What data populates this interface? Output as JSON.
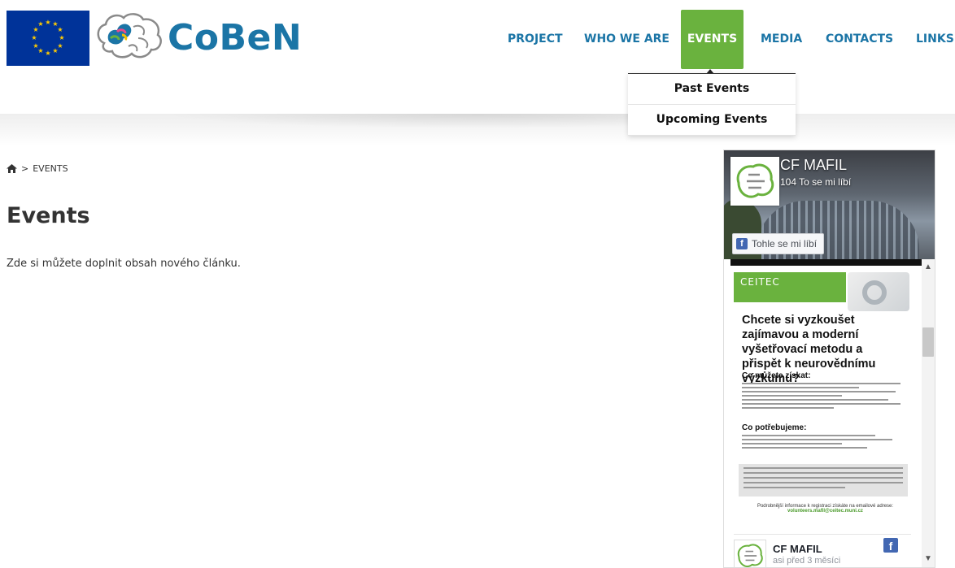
{
  "header": {
    "brand_name": "CoBeN",
    "flag_icon": "eu-flag-icon",
    "logo_icon": "brain-logo-icon"
  },
  "nav": {
    "items": [
      {
        "label": "PROJECT"
      },
      {
        "label": "WHO WE ARE"
      },
      {
        "label": "EVENTS",
        "active": true
      },
      {
        "label": "MEDIA"
      },
      {
        "label": "CONTACTS"
      },
      {
        "label": "LINKS"
      }
    ],
    "dropdown": [
      {
        "label": "Past Events"
      },
      {
        "label": "Upcoming Events"
      }
    ]
  },
  "breadcrumb": {
    "separator": ">",
    "current": "EVENTS"
  },
  "page": {
    "title": "Events",
    "text": "Zde si můžete doplnit obsah nového článku."
  },
  "facebook": {
    "page_name": "CF MAFIL",
    "likes": "104 To se mi líbí",
    "like_button": "Tohle se mi líbí",
    "poster": {
      "banner": "CEITEC",
      "headline": "Chcete si vyzkoušet zajímavou a moderní vyšetřovací metodu a přispět k neurovědnímu výzkumu?",
      "section1": "Co můžete získat:",
      "section2": "Co potřebujeme:",
      "contact_text": "Podrobnější informace k registraci získáte na emailové adrese:",
      "contact_email": "volunteers.mafil@ceitec.muni.cz"
    },
    "post": {
      "name": "CF MAFIL",
      "time": "asi před 3 měsíci"
    }
  },
  "colors": {
    "accent_green": "#6ab23e",
    "brand_blue": "#1b75a6",
    "eu_blue": "#003399",
    "facebook_blue": "#4267b2"
  }
}
